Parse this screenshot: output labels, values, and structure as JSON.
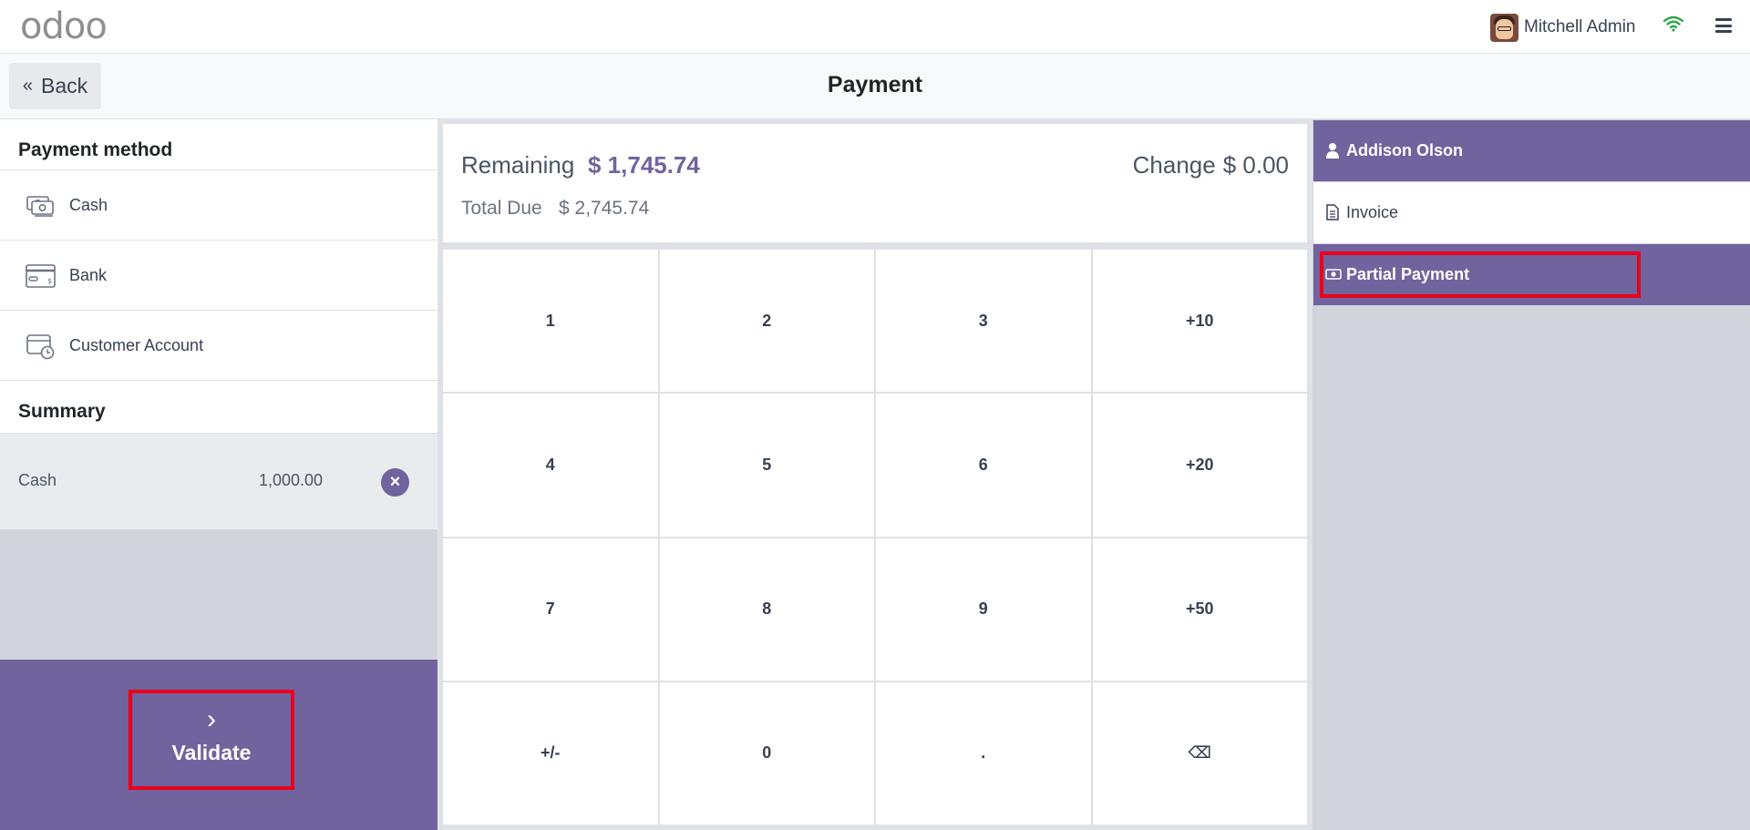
{
  "navbar": {
    "logo_text": "odoo",
    "user_name": "Mitchell Admin",
    "icons": {
      "wifi": "wifi-icon",
      "menu": "hamburger-menu-icon",
      "avatar": "user-avatar"
    }
  },
  "control": {
    "back_label": "Back",
    "back_icon": "«",
    "title": "Payment"
  },
  "payment_methods": {
    "header": "Payment method",
    "items": [
      {
        "label": "Cash",
        "icon": "cash-icon"
      },
      {
        "label": "Bank",
        "icon": "bank-card-icon"
      },
      {
        "label": "Customer Account",
        "icon": "customer-account-icon"
      }
    ]
  },
  "summary": {
    "header": "Summary",
    "lines": [
      {
        "method": "Cash",
        "amount": "1,000.00",
        "delete_icon": "×"
      }
    ]
  },
  "validate": {
    "label": "Validate",
    "icon": "›"
  },
  "status": {
    "remaining_label": "Remaining",
    "remaining_value": "$ 1,745.74",
    "total_due_label": "Total Due",
    "total_due_value": "$ 2,745.74",
    "change_label": "Change",
    "change_value": "$ 0.00"
  },
  "numpad": {
    "keys": [
      "1",
      "2",
      "3",
      "+10",
      "4",
      "5",
      "6",
      "+20",
      "7",
      "8",
      "9",
      "+50",
      "+/-",
      "0",
      ".",
      "⌫"
    ]
  },
  "right_panel": {
    "customer": "Addison Olson",
    "invoice": "Invoice",
    "partial_payment": "Partial Payment"
  },
  "colors": {
    "accent": "#71639e",
    "highlight": "#e8001c",
    "panel_bg": "#d1d5db"
  }
}
